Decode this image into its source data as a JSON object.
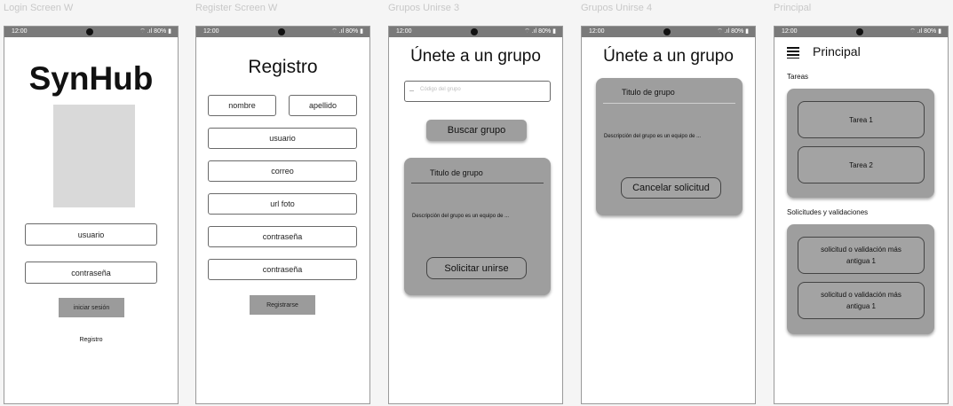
{
  "frames": {
    "login": "Login Screen W",
    "register": "Register Screen W",
    "grupos3": "Grupos Unirse 3",
    "grupos4": "Grupos Unirse 4",
    "principal": "Principal"
  },
  "status_bar": {
    "time": "12:00",
    "indicators": "⌔ .ıl 80% ▮"
  },
  "login": {
    "app_title": "SynHub",
    "username_label": "usuario",
    "password_label": "contraseña",
    "login_button": "iniciar sesión",
    "register_link": "Registro"
  },
  "register": {
    "title": "Registro",
    "first_name": "nombre",
    "last_name": "apellido",
    "username": "usuario",
    "email": "correo",
    "photo_url": "url foto",
    "password": "contraseña",
    "password_confirm": "contraseña",
    "submit": "Registrarse"
  },
  "grupos3": {
    "title": "Únete a un grupo",
    "code_placeholder": "Código del grupo",
    "search_button": "Buscar grupo",
    "group_title": "Titulo de grupo",
    "group_description": "Descripción del grupo es un equipo de ...",
    "join_button": "Solicitar unirse"
  },
  "grupos4": {
    "title": "Únete a un grupo",
    "group_title": "Titulo de grupo",
    "group_description": "Descripción del grupo es un equipo de ...",
    "cancel_button": "Cancelar solicitud"
  },
  "principal": {
    "title": "Principal",
    "tasks_heading": "Tareas",
    "tasks": [
      "Tarea 1",
      "Tarea 2"
    ],
    "requests_heading": "Solicitudes y validaciones",
    "requests": [
      "solicitud o validación más antigua 1",
      "solicitud o validación más antigua 1"
    ]
  },
  "colors": {
    "card": "#9e9e9e",
    "status_bar": "#7a7a7a",
    "image_placeholder": "#d9d9d9"
  }
}
